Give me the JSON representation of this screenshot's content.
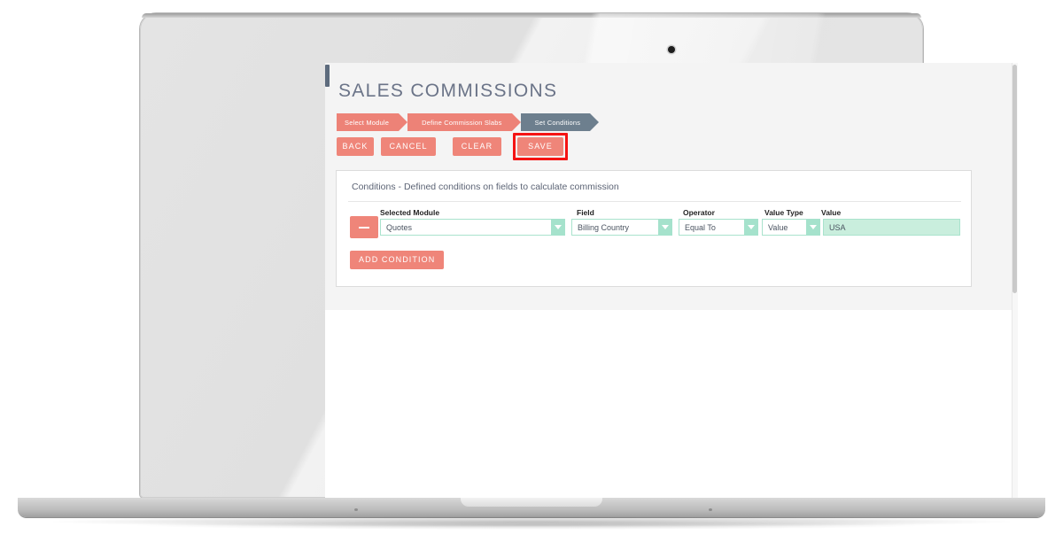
{
  "app": {
    "page_title": "SALES COMMISSIONS"
  },
  "wizard": {
    "steps": [
      {
        "label": "Select Module",
        "state": "done"
      },
      {
        "label": "Define Commission Slabs",
        "state": "done"
      },
      {
        "label": "Set Conditions",
        "state": "active"
      }
    ]
  },
  "toolbar": {
    "back_label": "BACK",
    "cancel_label": "CANCEL",
    "clear_label": "CLEAR",
    "save_label": "SAVE",
    "save_highlighted": true
  },
  "conditions_card": {
    "title": "Conditions - Defined conditions on fields to calculate commission",
    "columns": {
      "selected_module": "Selected Module",
      "field": "Field",
      "operator": "Operator",
      "value_type": "Value Type",
      "value": "Value"
    },
    "rows": [
      {
        "remove_icon": "minus-icon",
        "selected_module": "Quotes",
        "field": "Billing Country",
        "operator": "Equal To",
        "value_type": "Value",
        "value": "USA"
      }
    ],
    "add_condition_label": "ADD CONDITION"
  },
  "colors": {
    "accent_coral": "#ef8579",
    "step_active_slate": "#6d7f8e",
    "input_mint_border": "#a9e3cd",
    "input_mint_fill": "#c9eedd",
    "dropdown_mint": "#a5e2cc",
    "title_slate": "#6b7488",
    "highlight_red": "#f51313",
    "page_gray": "#f4f4f4"
  },
  "device": {
    "type": "laptop",
    "camera_icon": "camera-dot-icon"
  }
}
